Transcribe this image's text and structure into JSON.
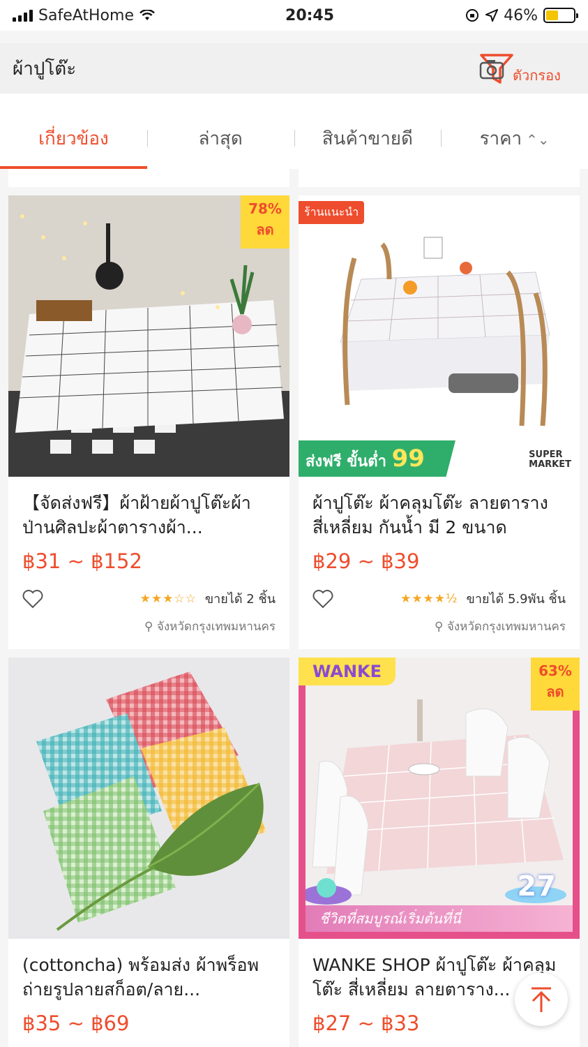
{
  "status_bar": {
    "carrier": "SafeAtHome",
    "time": "20:45",
    "battery": "46%"
  },
  "search": {
    "query": "ผ้าปูโต๊ะ",
    "filter_label": "ตัวกรอง"
  },
  "tabs": [
    {
      "label": "เกี่ยวข้อง"
    },
    {
      "label": "ล่าสุด"
    },
    {
      "label": "สินค้าขายดี"
    },
    {
      "label": "ราคา"
    }
  ],
  "products": [
    {
      "title": "【จัดส่งฟรี】ผ้าฝ้ายผ้าปูโต๊ะผ้าป่านศิลปะผ้าตารางผ้า...",
      "price": "฿31 ~ ฿152",
      "rating": 3,
      "rating_stars": "★★★☆☆",
      "sold": "ขายได้ 2 ชิ้น",
      "location": "จังหวัดกรุงเทพมหานคร",
      "discount_pct": "78%",
      "discount_word": "ลด"
    },
    {
      "title": "ผ้าปูโต๊ะ ผ้าคลุมโต๊ะ ลายตาราง สี่เหลี่ยม กันน้ำ มี 2 ขนาด",
      "price": "฿29 ~ ฿39",
      "rating": 4.5,
      "rating_stars": "★★★★½",
      "sold": "ขายได้ 5.9พัน ชิ้น",
      "location": "จังหวัดกรุงเทพมหานคร",
      "badge": "ร้านแนะนำ",
      "free_ship_text": "ส่งฟรี ขั้นต่ำ",
      "free_ship_min": "99",
      "supermarket_line1": "SUPER",
      "supermarket_line2": "MARKET"
    },
    {
      "title": "(cottoncha) พร้อมส่ง ผ้าพร็อพถ่ายรูปลายสก็อต/ลาย...",
      "price": "฿35 ~ ฿69"
    },
    {
      "title": "WANKE SHOP ผ้าปูโต๊ะ ผ้าคลุมโต๊ะ สี่เหลี่ยม ลายตาราง...",
      "price": "฿27 ~ ฿33",
      "discount_pct": "63%",
      "discount_word": "ลด",
      "shop_logo": "WANKE",
      "promo_banner": "ชีวิตที่สมบูรณ์เริ่มต้นที่นี่",
      "promo_day": "27"
    }
  ],
  "colors": {
    "accent": "#ee4d2d",
    "star": "#f5a623",
    "discount_bg": "#ffd839"
  }
}
